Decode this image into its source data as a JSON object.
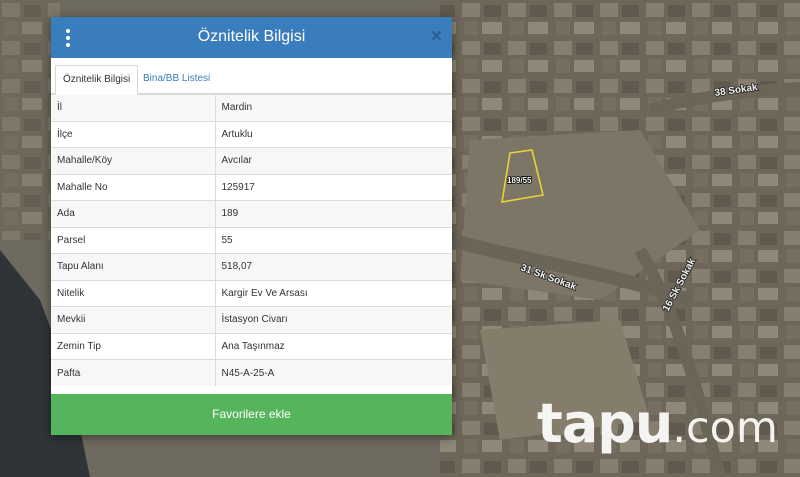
{
  "panel": {
    "title": "Öznitelik Bilgisi",
    "close_glyph": "×",
    "tabs": [
      {
        "label": "Öznitelik Bilgisi",
        "active": true
      },
      {
        "label": "Bina/BB Listesi",
        "active": false
      }
    ],
    "rows": [
      {
        "key": "İl",
        "value": "Mardin"
      },
      {
        "key": "İlçe",
        "value": "Artuklu"
      },
      {
        "key": "Mahalle/Köy",
        "value": "Avcılar"
      },
      {
        "key": "Mahalle No",
        "value": "125917"
      },
      {
        "key": "Ada",
        "value": "189"
      },
      {
        "key": "Parsel",
        "value": "55"
      },
      {
        "key": "Tapu Alanı",
        "value": "518,07"
      },
      {
        "key": "Nitelik",
        "value": "Kargir Ev Ve Arsası"
      },
      {
        "key": "Mevkii",
        "value": "İstasyon Civarı"
      },
      {
        "key": "Zemin Tip",
        "value": "Ana Taşınmaz"
      },
      {
        "key": "Pafta",
        "value": "N45-A-25-A"
      }
    ],
    "favorite_button": "Favorilere ekle"
  },
  "map": {
    "streets": [
      "38 Sokak",
      "31 Sk Sokak",
      "16 Sk Sokak"
    ],
    "parcel_label": "189/55"
  },
  "watermark": {
    "main": "tapu",
    "tld": ".com"
  },
  "colors": {
    "header": "#3a7dbd",
    "button": "#55b45c",
    "parcel_outline": "#e8d23a"
  },
  "icons": [
    "more-vertical-icon",
    "close-icon"
  ]
}
